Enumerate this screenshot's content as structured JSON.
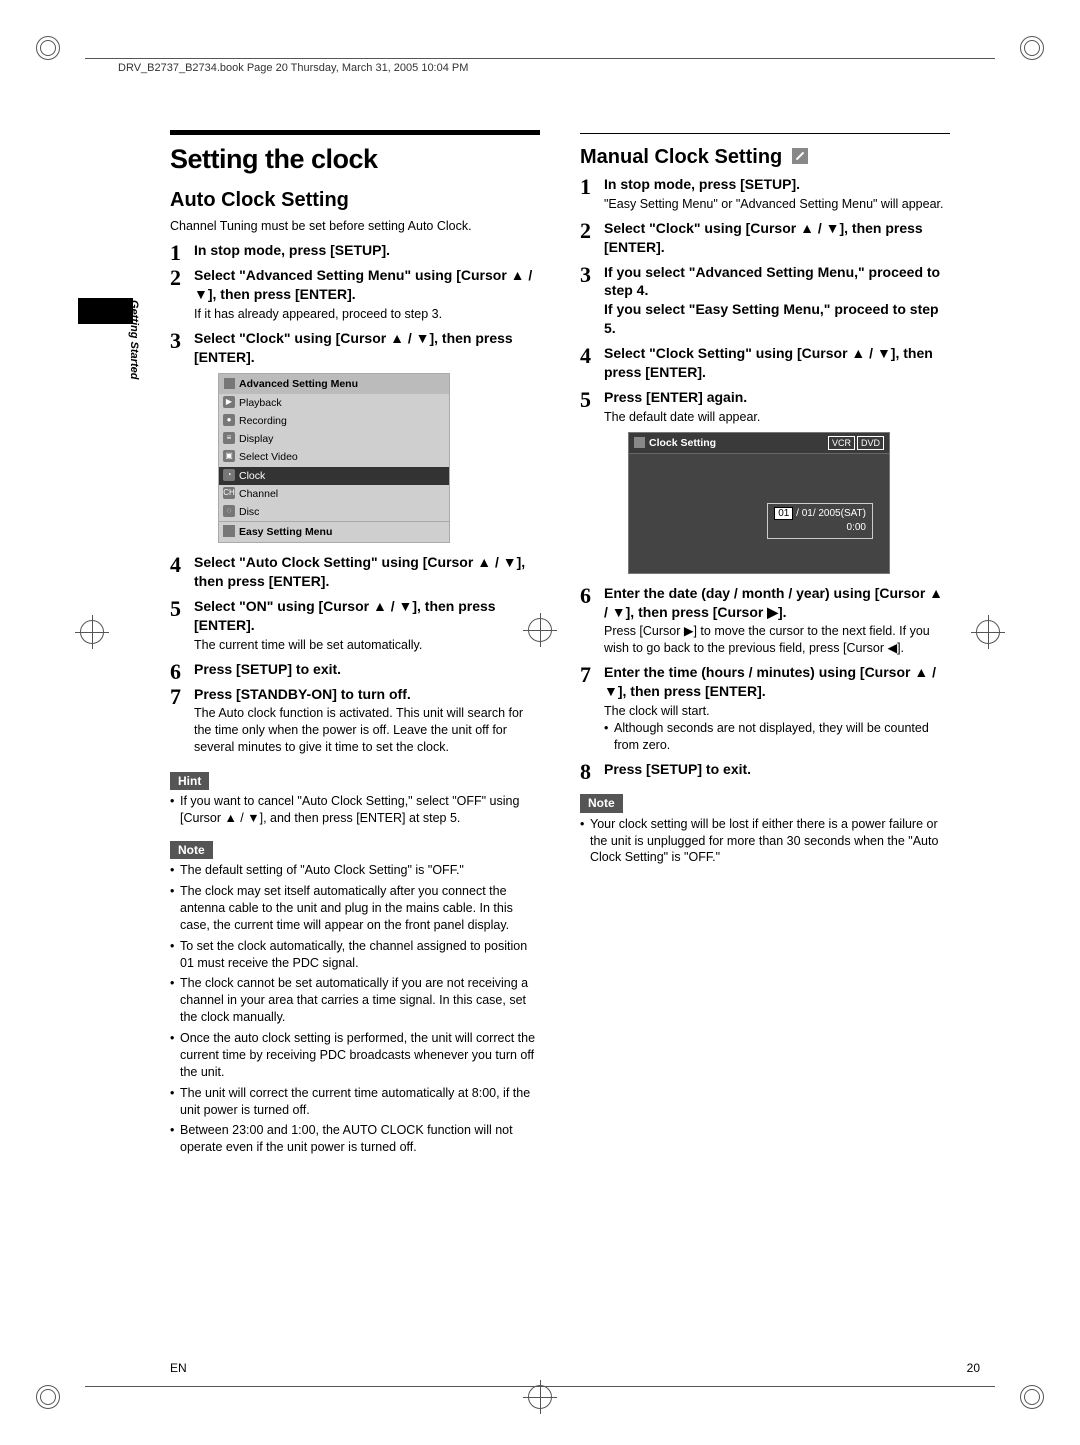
{
  "running_head": "DRV_B2737_B2734.book  Page 20  Thursday, March 31, 2005  10:04 PM",
  "side_label": "Getting Started",
  "footer": {
    "left": "EN",
    "right": "20"
  },
  "left": {
    "h1": "Setting the clock",
    "h2": "Auto Clock Setting",
    "intro": "Channel Tuning must be set before setting Auto Clock.",
    "steps": [
      {
        "title": "In stop mode, press [SETUP]."
      },
      {
        "title": "Select \"Advanced Setting Menu\" using [Cursor ▲ / ▼], then press [ENTER].",
        "body": "If it has already appeared, proceed to step 3."
      },
      {
        "title": "Select \"Clock\" using [Cursor ▲ / ▼], then press [ENTER]."
      },
      {
        "title": "Select \"Auto Clock Setting\" using [Cursor ▲ / ▼], then press [ENTER]."
      },
      {
        "title": "Select \"ON\" using [Cursor ▲ / ▼], then press [ENTER].",
        "body": "The current time will be set automatically."
      },
      {
        "title": "Press [SETUP] to exit."
      },
      {
        "title": "Press [STANDBY-ON] to turn off.",
        "body": "The Auto clock function is activated.\nThis unit will search for the time only when the power is off. Leave the unit off for several minutes to give it time to set the clock."
      }
    ],
    "osd": {
      "header": "Advanced Setting Menu",
      "items": [
        "Playback",
        "Recording",
        "Display",
        "Select Video",
        "Clock",
        "Channel",
        "Disc"
      ],
      "selected_index": 4,
      "footer": "Easy Setting Menu"
    },
    "hint_label": "Hint",
    "hint_items": [
      "If you want to cancel \"Auto Clock Setting,\" select \"OFF\" using [Cursor ▲ / ▼], and then press [ENTER] at step 5."
    ],
    "note_label": "Note",
    "note_items": [
      "The default setting of \"Auto Clock Setting\" is \"OFF.\"",
      "The clock may set itself automatically after you connect the antenna cable to the unit and plug in the mains cable. In this case, the current time will appear on the front panel display.",
      "To set the clock automatically, the channel assigned to position 01 must receive the PDC signal.",
      "The clock cannot be set automatically if you are not receiving a channel in your area that carries a time signal. In this case, set the clock manually.",
      "Once the auto clock setting is performed, the unit will correct the current time by receiving PDC broadcasts whenever you turn off the unit.",
      "The unit will correct the current time automatically at 8:00, if the unit power is turned off.",
      "Between 23:00 and 1:00, the AUTO CLOCK function will not operate even if the unit power is turned off."
    ]
  },
  "right": {
    "h2": "Manual Clock Setting",
    "steps": [
      {
        "title": "In stop mode, press [SETUP].",
        "body": "\"Easy Setting Menu\" or \"Advanced Setting Menu\" will appear."
      },
      {
        "title": "Select \"Clock\" using [Cursor ▲ / ▼], then press [ENTER]."
      },
      {
        "title": "If you select \"Advanced Setting Menu,\" proceed to step 4.\nIf you select \"Easy Setting Menu,\" proceed to step 5."
      },
      {
        "title": "Select \"Clock Setting\" using [Cursor ▲ / ▼], then press [ENTER]."
      },
      {
        "title": "Press [ENTER] again.",
        "body": "The default date will appear."
      },
      {
        "title": "Enter the date (day / month / year) using [Cursor ▲ / ▼], then press [Cursor ▶].",
        "body": "Press [Cursor ▶] to move the cursor to the next field. If you wish to go back to the previous field, press [Cursor ◀]."
      },
      {
        "title": "Enter the time (hours / minutes) using [Cursor ▲ / ▼], then press [ENTER].",
        "body": "The clock will start.",
        "bullets": [
          "Although seconds are not displayed, they will be counted from zero."
        ]
      },
      {
        "title": "Press [SETUP] to exit."
      }
    ],
    "osd": {
      "header": "Clock Setting",
      "tags": [
        "VCR",
        "DVD"
      ],
      "date_line": {
        "hl": "01",
        "rest": " / 01/ 2005(SAT)"
      },
      "time_line": "0:00"
    },
    "note_label": "Note",
    "note_items": [
      "Your clock setting will be lost if either there is a power failure or the unit is unplugged for more than 30 seconds when the \"Auto Clock Setting\" is \"OFF.\""
    ]
  }
}
